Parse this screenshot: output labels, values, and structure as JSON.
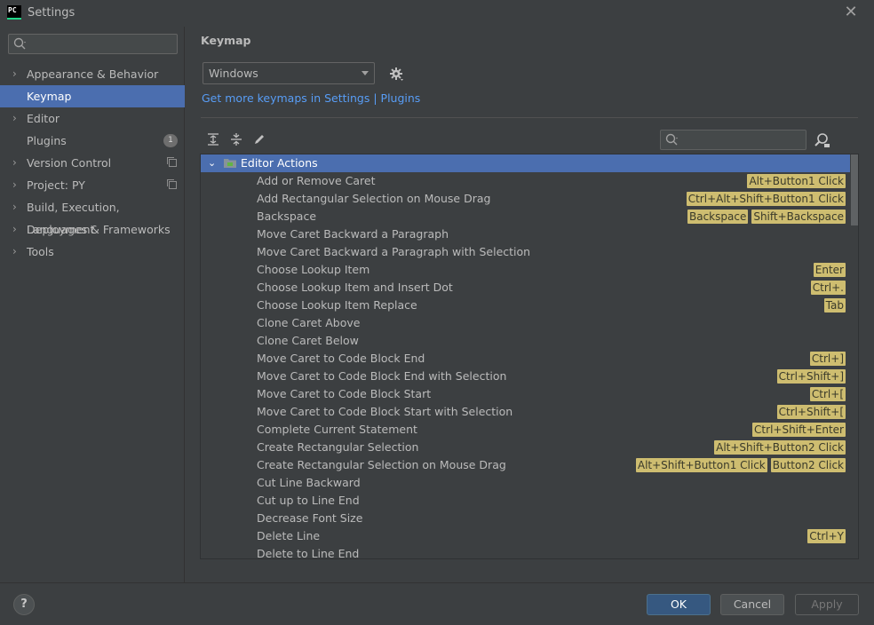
{
  "window": {
    "title": "Settings",
    "app_icon_text": "PC"
  },
  "sidebar": {
    "search": {
      "value": "",
      "placeholder": ""
    },
    "items": [
      {
        "label": "Appearance & Behavior",
        "expandable": true
      },
      {
        "label": "Keymap",
        "expandable": false,
        "selected": true
      },
      {
        "label": "Editor",
        "expandable": true
      },
      {
        "label": "Plugins",
        "expandable": false,
        "badge": "1"
      },
      {
        "label": "Version Control",
        "expandable": true,
        "copy_icon": true
      },
      {
        "label": "Project: PY",
        "expandable": true,
        "copy_icon": true
      },
      {
        "label": "Build, Execution, Deployment",
        "expandable": true
      },
      {
        "label": "Languages & Frameworks",
        "expandable": true
      },
      {
        "label": "Tools",
        "expandable": true
      }
    ]
  },
  "main": {
    "title": "Keymap",
    "keymap_select": {
      "value": "Windows"
    },
    "link": "Get more keymaps in Settings | Plugins",
    "filter": {
      "value": ""
    }
  },
  "tree": {
    "group": {
      "label": "Editor Actions",
      "expanded": true
    },
    "actions": [
      {
        "label": "Add or Remove Caret",
        "shortcuts": [
          "Alt+Button1 Click"
        ]
      },
      {
        "label": "Add Rectangular Selection on Mouse Drag",
        "shortcuts": [
          "Ctrl+Alt+Shift+Button1 Click"
        ]
      },
      {
        "label": "Backspace",
        "shortcuts": [
          "Backspace",
          "Shift+Backspace"
        ]
      },
      {
        "label": "Move Caret Backward a Paragraph",
        "shortcuts": []
      },
      {
        "label": "Move Caret Backward a Paragraph with Selection",
        "shortcuts": []
      },
      {
        "label": "Choose Lookup Item",
        "shortcuts": [
          "Enter"
        ]
      },
      {
        "label": "Choose Lookup Item and Insert Dot",
        "shortcuts": [
          "Ctrl+."
        ]
      },
      {
        "label": "Choose Lookup Item Replace",
        "shortcuts": [
          "Tab"
        ]
      },
      {
        "label": "Clone Caret Above",
        "shortcuts": []
      },
      {
        "label": "Clone Caret Below",
        "shortcuts": []
      },
      {
        "label": "Move Caret to Code Block End",
        "shortcuts": [
          "Ctrl+]"
        ]
      },
      {
        "label": "Move Caret to Code Block End with Selection",
        "shortcuts": [
          "Ctrl+Shift+]"
        ]
      },
      {
        "label": "Move Caret to Code Block Start",
        "shortcuts": [
          "Ctrl+["
        ]
      },
      {
        "label": "Move Caret to Code Block Start with Selection",
        "shortcuts": [
          "Ctrl+Shift+["
        ]
      },
      {
        "label": "Complete Current Statement",
        "shortcuts": [
          "Ctrl+Shift+Enter"
        ]
      },
      {
        "label": "Create Rectangular Selection",
        "shortcuts": [
          "Alt+Shift+Button2 Click"
        ]
      },
      {
        "label": "Create Rectangular Selection on Mouse Drag",
        "shortcuts": [
          "Alt+Shift+Button1 Click",
          "Button2 Click"
        ]
      },
      {
        "label": "Cut Line Backward",
        "shortcuts": []
      },
      {
        "label": "Cut up to Line End",
        "shortcuts": []
      },
      {
        "label": "Decrease Font Size",
        "shortcuts": []
      },
      {
        "label": "Delete Line",
        "shortcuts": [
          "Ctrl+Y"
        ]
      },
      {
        "label": "Delete to Line End",
        "shortcuts": []
      }
    ]
  },
  "footer": {
    "help_label": "?",
    "ok_label": "OK",
    "cancel_label": "Cancel",
    "apply_label": "Apply"
  },
  "colors": {
    "selection": "#4b6eaf",
    "link": "#589df6",
    "shortcut_bg": "#cebd70",
    "ok_button": "#365880"
  }
}
